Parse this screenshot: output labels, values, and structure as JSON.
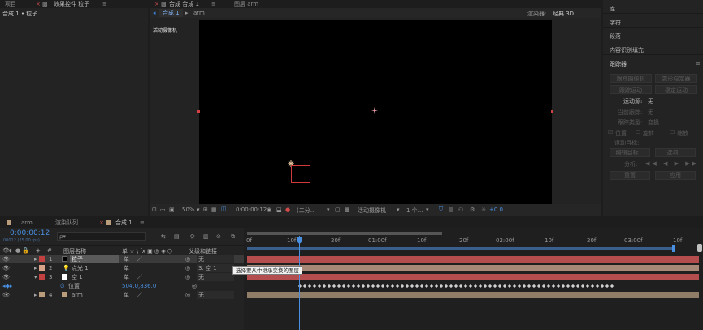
{
  "left_panel": {
    "tab_project": "项目",
    "tab_effects": "效果控件 粒子",
    "breadcrumb": "合成 1 • 粒子"
  },
  "comp_panel": {
    "tab_comp": "合成 合成 1",
    "tab_layer": "图层 arm",
    "subtab_comp1": "合成 1",
    "subtab_arm": "arm",
    "renderer_label": "渲染器:",
    "renderer_value": "经典 3D",
    "camera_label": "活动摄像机",
    "footer": {
      "zoom": "50%",
      "timecode": "0:00:00:12",
      "resolution": "(二分…",
      "view": "活动摄像机",
      "views": "1 个…",
      "exposure": "+0.0"
    }
  },
  "right_panel": {
    "items": [
      "库",
      "字符",
      "段落",
      "内容识别填充"
    ],
    "tracker_title": "跟踪器",
    "tracker_buttons": [
      "跟踪摄像机",
      "变形稳定器",
      "跟踪运动",
      "稳定运动"
    ],
    "motion_source_label": "运动源:",
    "motion_source_value": "无",
    "current_track_label": "当前跟踪:",
    "current_track_value": "无",
    "track_type_label": "跟踪类型:",
    "track_type_value": "变换",
    "check_position": "位置",
    "check_rotation": "旋转",
    "check_scale": "缩放",
    "motion_target_label": "运动目标:",
    "edit_target": "编辑目标...",
    "options": "选项...",
    "analyze_label": "分析:",
    "reset": "重置",
    "apply": "应用"
  },
  "timeline": {
    "tab_arm": "arm",
    "tab_render_queue": "渲染队列",
    "tab_comp1": "合成 1",
    "timecode": "0:00:00:12",
    "timecode_sub": "00012 (25.00 fps)",
    "search_placeholder": "ρ▾",
    "header_layer_name": "图层名称",
    "header_switches": "单 ☆ \\ fx ▣ ◎ ◈ ⬡",
    "header_parent": "父级和链接",
    "ruler": [
      "0f",
      "10f",
      "20f",
      "01:00f",
      "10f",
      "20f",
      "02:00f",
      "10f",
      "20f",
      "03:00f",
      "10f"
    ],
    "tooltip": "选择要从中继承变换的图层",
    "layers": [
      {
        "num": "1",
        "name": "粒子",
        "parent": "无",
        "color": "#c24040",
        "swatch": "#000000"
      },
      {
        "num": "2",
        "name": "点光 1",
        "parent": "3. 空 1",
        "color": "#d9a38a",
        "swatch": ""
      },
      {
        "num": "3",
        "name": "空 1",
        "parent": "无",
        "color": "#c24040",
        "swatch": "#ffffff"
      },
      {
        "num": "",
        "name": "位置",
        "parent": "",
        "value": "504.0,836.0"
      },
      {
        "num": "4",
        "name": "arm",
        "parent": "无",
        "color": "#b99c7c",
        "swatch": "#b99c7c"
      }
    ]
  }
}
